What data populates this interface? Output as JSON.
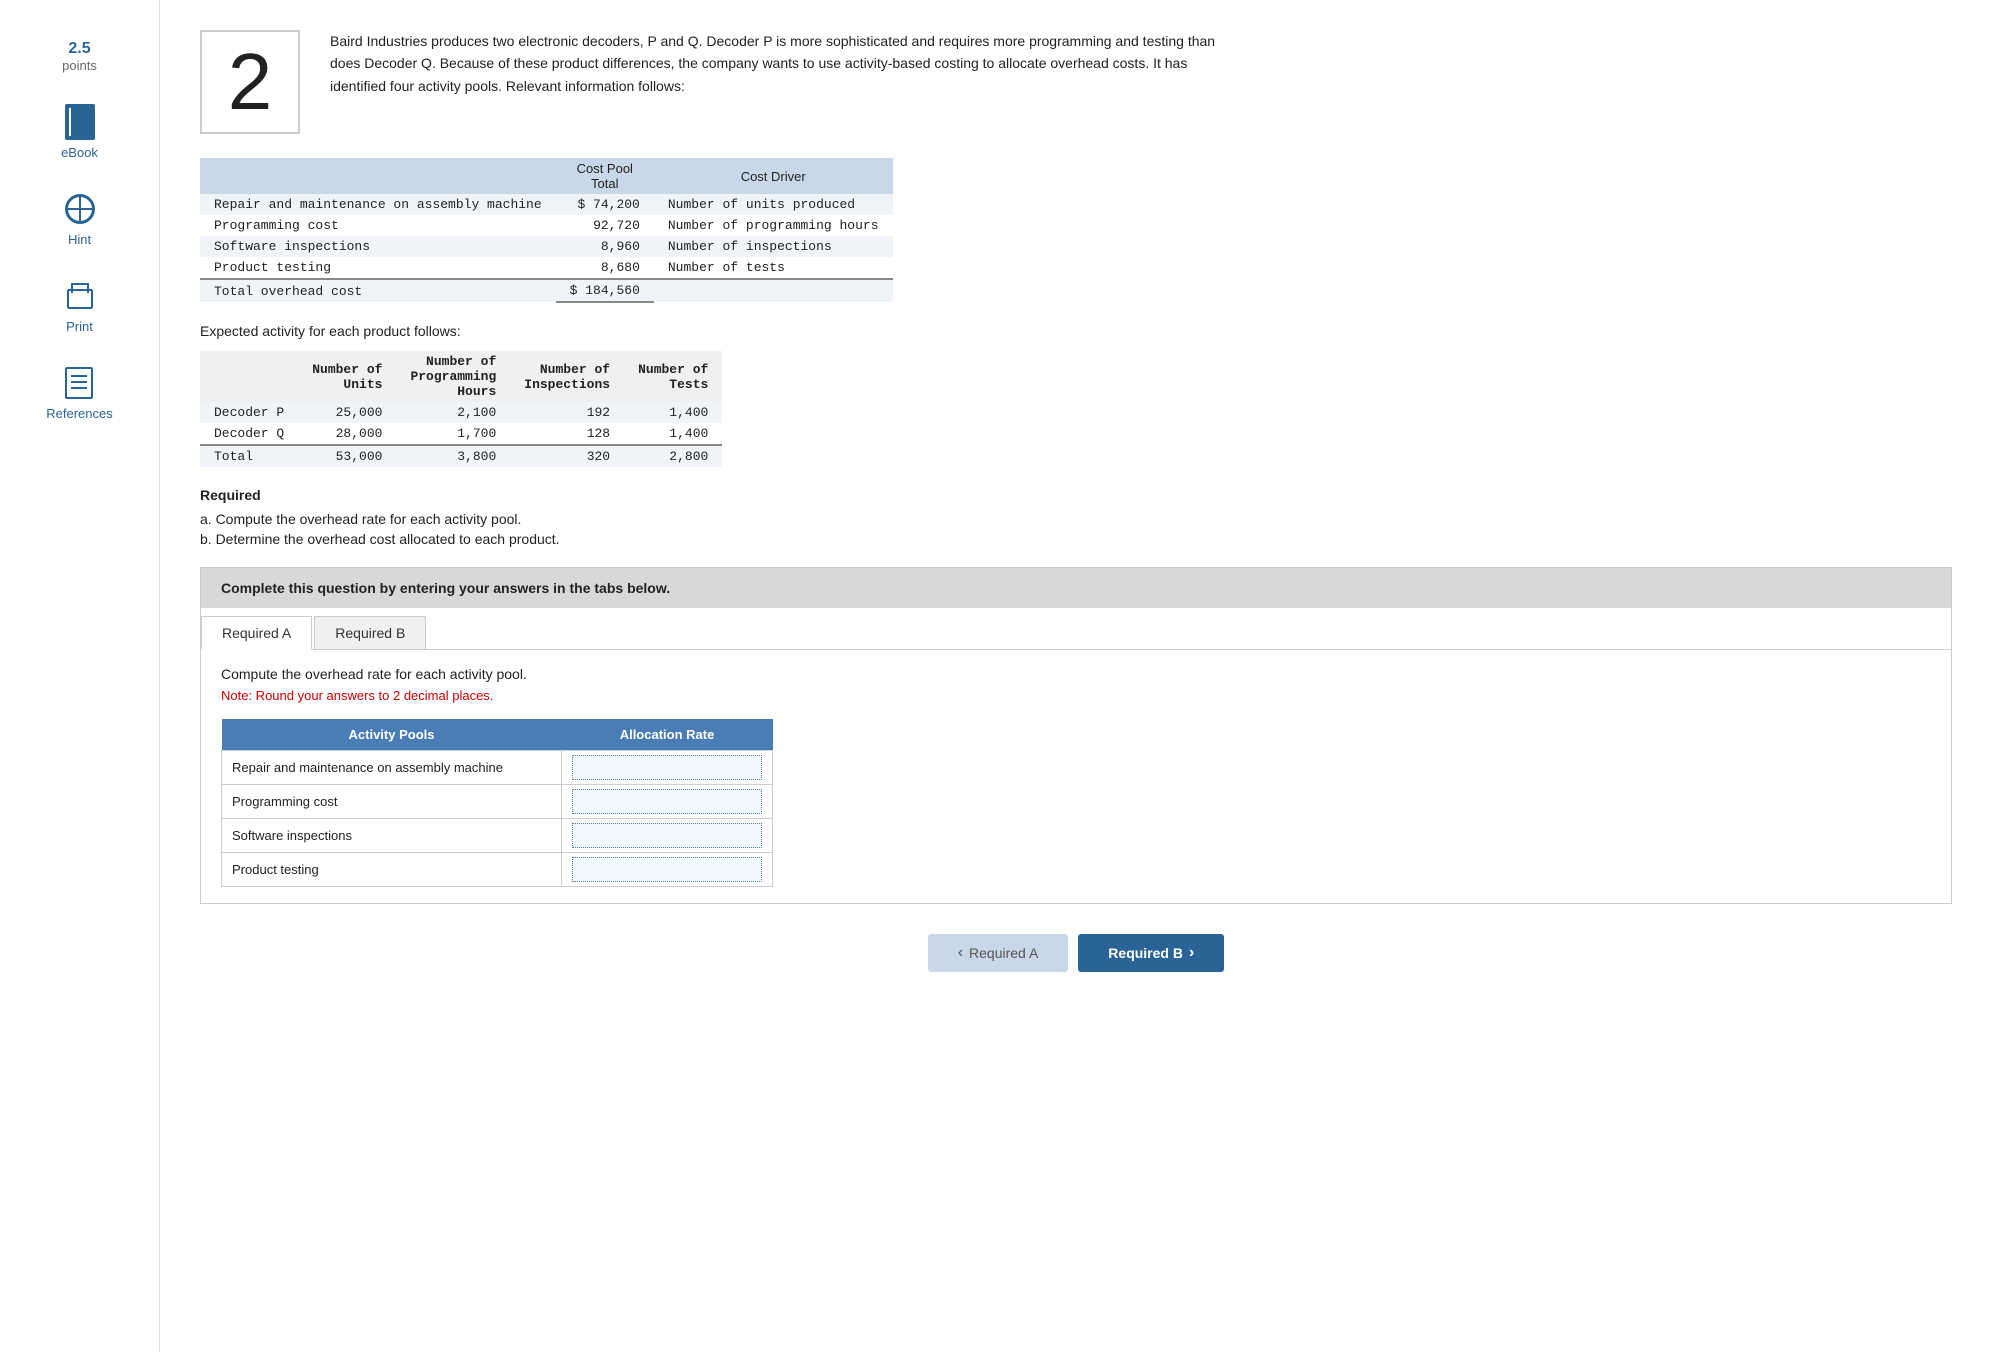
{
  "question": {
    "number": "2",
    "text": "Baird Industries produces two electronic decoders, P and Q. Decoder P is more sophisticated and requires more programming and testing than does Decoder Q. Because of these product differences, the company wants to use activity-based costing to allocate overhead costs. It has identified four activity pools. Relevant information follows:"
  },
  "sidebar": {
    "points_num": "2.5",
    "points_label": "points",
    "ebook_label": "eBook",
    "hint_label": "Hint",
    "print_label": "Print",
    "references_label": "References"
  },
  "cost_pool_table": {
    "header_col1": "Activity Pools",
    "header_col2": "Cost Pool Total",
    "header_col3": "Cost Driver",
    "rows": [
      {
        "activity": "Repair and maintenance on assembly machine",
        "total": "$ 74,200",
        "driver": "Number of units produced"
      },
      {
        "activity": "Programming cost",
        "total": "92,720",
        "driver": "Number of programming hours"
      },
      {
        "activity": "Software inspections",
        "total": "8,960",
        "driver": "Number of inspections"
      },
      {
        "activity": "Product testing",
        "total": "8,680",
        "driver": "Number of tests"
      }
    ],
    "total_label": "Total overhead cost",
    "total_value": "$ 184,560"
  },
  "expected_activity": {
    "intro": "Expected activity for each product follows:",
    "header": [
      "",
      "Number of Units",
      "Number of Programming Hours",
      "Number of Inspections",
      "Number of Tests"
    ],
    "rows": [
      {
        "product": "Decoder P",
        "units": "25,000",
        "hours": "2,100",
        "inspections": "192",
        "tests": "1,400"
      },
      {
        "product": "Decoder Q",
        "units": "28,000",
        "hours": "1,700",
        "inspections": "128",
        "tests": "1,400"
      },
      {
        "product": "Total",
        "units": "53,000",
        "hours": "3,800",
        "inspections": "320",
        "tests": "2,800"
      }
    ]
  },
  "required": {
    "heading": "Required",
    "part_a": "a. Compute the overhead rate for each activity pool.",
    "part_b": "b. Determine the overhead cost allocated to each product."
  },
  "answer_box": {
    "header": "Complete this question by entering your answers in the tabs below.",
    "tabs": [
      {
        "label": "Required A",
        "active": true
      },
      {
        "label": "Required B",
        "active": false
      }
    ],
    "tab_instruction": "Compute the overhead rate for each activity pool.",
    "tab_note": "Note: Round your answers to 2 decimal places.",
    "input_table": {
      "col1_header": "Activity Pools",
      "col2_header": "Allocation Rate",
      "rows": [
        {
          "pool": "Repair and maintenance on assembly machine",
          "value": ""
        },
        {
          "pool": "Programming cost",
          "value": ""
        },
        {
          "pool": "Software inspections",
          "value": ""
        },
        {
          "pool": "Product testing",
          "value": ""
        }
      ]
    }
  },
  "nav_buttons": {
    "prev_label": "Required A",
    "next_label": "Required B"
  }
}
